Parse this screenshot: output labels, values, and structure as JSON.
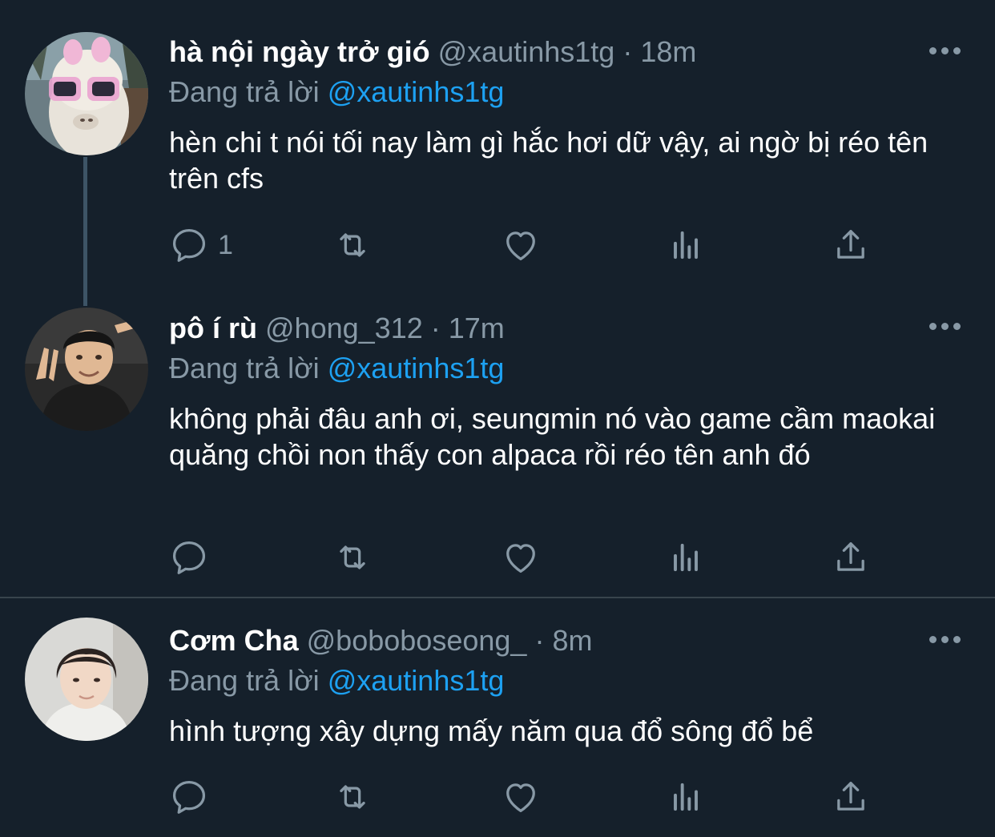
{
  "tweets": [
    {
      "name": "hà nội ngày trở gió",
      "handle": "@xautinhs1tg",
      "separator": "·",
      "time": "18m",
      "reply_label": "Đang trả lời",
      "reply_to": "@xautinhs1tg",
      "text": "hèn chi t nói tối nay làm gì hắc hơi dữ vậy, ai ngờ bị réo tên trên cfs",
      "reply_count": "1",
      "avatar": "alpaca-with-sunglasses"
    },
    {
      "name": "pô í rù",
      "handle": "@hong_312",
      "separator": "·",
      "time": "17m",
      "reply_label": "Đang trả lời",
      "reply_to": "@xautinhs1tg",
      "text": "không phải đâu anh ơi, seungmin nó vào game cầm maokai quăng chồi non thấy con alpaca rồi réo tên anh đó",
      "reply_count": "",
      "avatar": "man-peace-sign"
    },
    {
      "name": "Cơm Cha",
      "handle": "@boboboseong_",
      "separator": "·",
      "time": "8m",
      "reply_label": "Đang trả lời",
      "reply_to": "@xautinhs1tg",
      "text": "hình tượng xây dựng mấy năm qua đổ sông đổ bể",
      "reply_count": "",
      "avatar": "young-man-portrait"
    }
  ],
  "icons": {
    "reply": "comment-icon",
    "retweet": "retweet-icon",
    "like": "heart-icon",
    "stats": "analytics-icon",
    "share": "share-icon",
    "more": "more-dots-icon"
  },
  "colors": {
    "background": "#15202b",
    "text": "#ffffff",
    "secondary": "#8899a6",
    "accent": "#1da1f2",
    "divider": "#38444d",
    "thread_line": "#3d5466"
  }
}
